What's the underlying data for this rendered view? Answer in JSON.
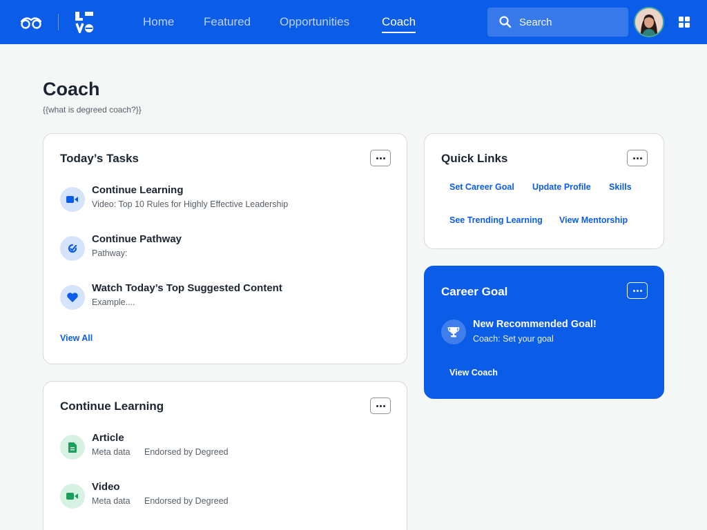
{
  "header": {
    "nav": [
      {
        "label": "Home",
        "active": false
      },
      {
        "label": "Featured",
        "active": false
      },
      {
        "label": "Opportunities",
        "active": false
      },
      {
        "label": "Coach",
        "active": true
      }
    ],
    "search_placeholder": "Search",
    "accent_color": "#0b5ce6"
  },
  "page": {
    "title": "Coach",
    "subtitle": "{{what is degreed coach?}}"
  },
  "todays_tasks": {
    "title": "Today’s Tasks",
    "items": [
      {
        "icon": "video-icon",
        "title": "Continue Learning",
        "subtitle": "Video: Top 10 Rules for Highly Effective Leadership"
      },
      {
        "icon": "pathway-icon",
        "title": "Continue Pathway",
        "subtitle": "Pathway:"
      },
      {
        "icon": "heart-icon",
        "title": "Watch Today’s Top Suggested Content",
        "subtitle": "Example...."
      }
    ],
    "view_all": "View All"
  },
  "continue_learning": {
    "title": "Continue Learning",
    "items": [
      {
        "icon": "article-icon",
        "title": "Article",
        "meta": "Meta data",
        "endorsed": "Endorsed by Degreed"
      },
      {
        "icon": "video-icon",
        "title": "Video",
        "meta": "Meta data",
        "endorsed": "Endorsed by Degreed"
      }
    ]
  },
  "quick_links": {
    "title": "Quick Links",
    "links": [
      "Set Career Goal",
      "Update Profile",
      "Skills",
      "See Trending Learning",
      "View Mentorship"
    ]
  },
  "career_goal": {
    "title": "Career Goal",
    "goal_title": "New Recommended Goal!",
    "goal_subtitle": "Coach: Set your goal",
    "link": "View Coach",
    "icon": "trophy-icon"
  }
}
